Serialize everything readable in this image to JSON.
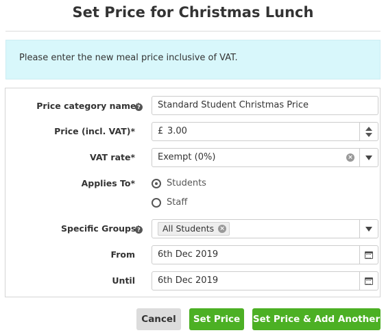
{
  "dialog": {
    "title": "Set Price for Christmas Lunch",
    "info": "Please enter the new meal price inclusive of VAT."
  },
  "form": {
    "category": {
      "label": "Price category name*",
      "value": "Standard Student Christmas Price"
    },
    "price": {
      "label": "Price (incl. VAT)*",
      "currency": "£",
      "value": "3.00"
    },
    "vat": {
      "label": "VAT rate*",
      "value": "Exempt (0%)"
    },
    "applies_to": {
      "label": "Applies To*",
      "options": [
        {
          "label": "Students",
          "checked": true
        },
        {
          "label": "Staff",
          "checked": false
        }
      ]
    },
    "groups": {
      "label": "Specific Groups*",
      "tags": [
        "All Students"
      ]
    },
    "from": {
      "label": "From",
      "value": "6th Dec 2019"
    },
    "until": {
      "label": "Until",
      "value": "6th Dec 2019"
    }
  },
  "icons": {
    "help": "question-circle-icon",
    "clear": "clear-circle-icon",
    "dropdown": "caret-down-icon",
    "calendar": "calendar-icon",
    "spinner": "up-down-arrows-icon"
  },
  "buttons": {
    "cancel": "Cancel",
    "set_price": "Set Price",
    "set_price_add": "Set Price & Add Another"
  },
  "colors": {
    "info_bg": "#d8f7fb",
    "primary_green": "#4cb024",
    "cancel_grey": "#dcdcdc"
  }
}
